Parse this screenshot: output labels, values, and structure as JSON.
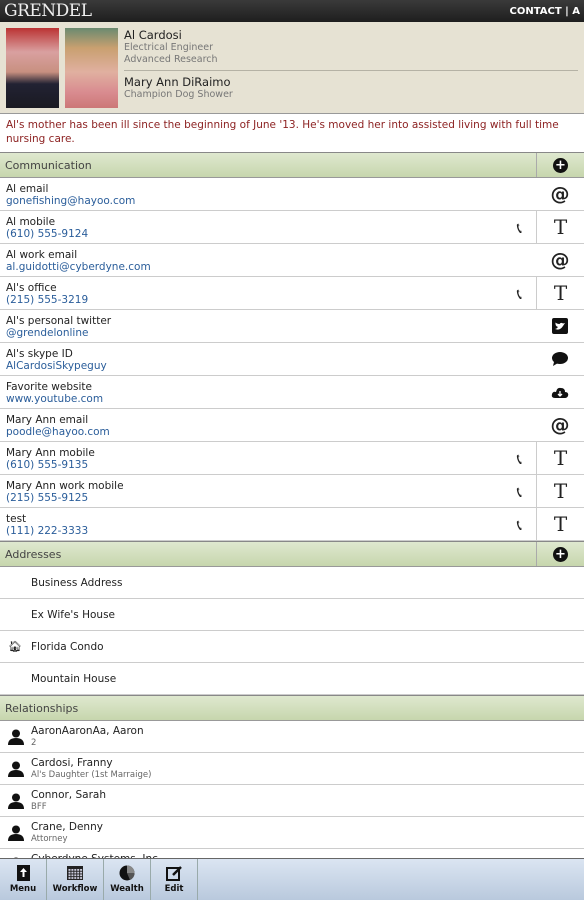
{
  "header": {
    "logo": "GRENDEL",
    "nav": "CONTACT | A"
  },
  "profile": {
    "primary": {
      "name": "Al Cardosi",
      "title": "Electrical Engineer",
      "department": "Advanced Research"
    },
    "secondary": {
      "name": "Mary Ann DiRaimo",
      "title": "Champion Dog Shower"
    }
  },
  "note": "Al's mother has been ill since the beginning of June '13.  He's moved her into assisted living with full time nursing care.",
  "communication": {
    "title": "Communication",
    "items": [
      {
        "label": "Al email",
        "value": "gonefishing@hayoo.com",
        "action": "@",
        "call": false
      },
      {
        "label": "Al mobile",
        "value": "(610) 555-9124",
        "action": "T",
        "call": true
      },
      {
        "label": "Al work email",
        "value": "al.guidotti@cyberdyne.com",
        "action": "@",
        "call": false
      },
      {
        "label": "Al's office",
        "value": "(215) 555-3219",
        "action": "T",
        "call": true
      },
      {
        "label": "Al's personal twitter",
        "value": "@grendelonline",
        "action": "twitter",
        "call": false
      },
      {
        "label": "Al's skype ID",
        "value": "AlCardosiSkypeguy",
        "action": "chat",
        "call": false
      },
      {
        "label": "Favorite website",
        "value": "www.youtube.com",
        "action": "cloud",
        "call": false
      },
      {
        "label": "Mary Ann email",
        "value": "poodle@hayoo.com",
        "action": "@",
        "call": false
      },
      {
        "label": "Mary Ann mobile",
        "value": "(610) 555-9135",
        "action": "T",
        "call": true
      },
      {
        "label": "Mary Ann work mobile",
        "value": "(215) 555-9125",
        "action": "T",
        "call": true
      },
      {
        "label": "test",
        "value": "(111) 222-3333",
        "action": "T",
        "call": true
      }
    ]
  },
  "addresses": {
    "title": "Addresses",
    "items": [
      {
        "label": "Business Address",
        "home": false
      },
      {
        "label": "Ex Wife's House",
        "home": false
      },
      {
        "label": "Florida Condo",
        "home": true
      },
      {
        "label": "Mountain House",
        "home": false
      }
    ]
  },
  "relationships": {
    "title": "Relationships",
    "items": [
      {
        "name": "AaronAaronAa, Aaron",
        "relation": "2"
      },
      {
        "name": "Cardosi, Franny",
        "relation": "Al's Daughter (1st Marraige)"
      },
      {
        "name": "Connor, Sarah",
        "relation": "BFF"
      },
      {
        "name": "Crane, Denny",
        "relation": "Attorney"
      },
      {
        "name": "Cyberdyne Systems, Inc.",
        "relation": ""
      }
    ]
  },
  "toolbar": [
    {
      "label": "Menu",
      "icon": "menu-upload"
    },
    {
      "label": "Workflow",
      "icon": "calendar"
    },
    {
      "label": "Wealth",
      "icon": "pie-chart"
    },
    {
      "label": "Edit",
      "icon": "edit"
    }
  ]
}
